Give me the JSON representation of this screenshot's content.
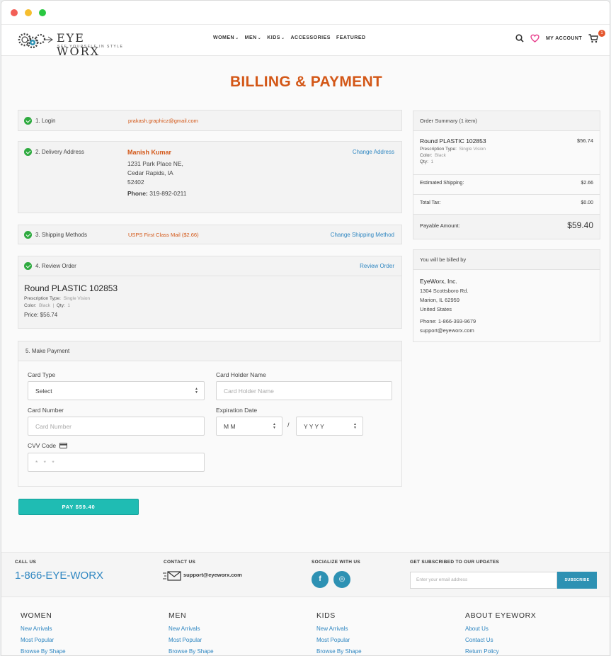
{
  "window": {
    "controls": [
      "close",
      "minimize",
      "maximize"
    ]
  },
  "header": {
    "logo_name": "EYE WORX",
    "logo_tagline": "SEE YOURSELF IN STYLE",
    "nav": [
      {
        "label": "WOMEN",
        "caret": "⌄"
      },
      {
        "label": "MEN",
        "caret": "⌄"
      },
      {
        "label": "KIDS",
        "caret": "⌄"
      },
      {
        "label": "ACCESSORIES",
        "caret": ""
      },
      {
        "label": "FEATURED",
        "caret": ""
      }
    ],
    "account": "MY ACCOUNT",
    "cart_count": "1"
  },
  "page_title": "BILLING & PAYMENT",
  "steps": {
    "login": {
      "label": "1. Login",
      "value": "prakash.graphicz@gmail.com"
    },
    "delivery": {
      "label": "2. Delivery Address",
      "name": "Manish Kumar",
      "line1": "1231 Park Place NE,",
      "line2": "Cedar Rapids, IA",
      "line3": "52402",
      "phone_label": "Phone:",
      "phone": "319-892-0211",
      "action": "Change Address"
    },
    "shipping": {
      "label": "3. Shipping Methods",
      "value": "USPS First Class Mail ($2.66)",
      "action": "Change Shipping Method"
    },
    "review": {
      "label": "4. Review Order",
      "action": "Review Order",
      "product": "Round PLASTIC 102853",
      "rx_label": "Prescription Type:",
      "rx_value": "Single Vision",
      "color_label": "Color:",
      "color_value": "Black",
      "sep": "|",
      "qty_label": "Qty:",
      "qty_value": "1",
      "price": "Price: $56.74"
    },
    "payment": {
      "label": "5. Make Payment",
      "card_type_label": "Card Type",
      "card_type_value": "Select",
      "holder_label": "Card Holder Name",
      "holder_placeholder": "Card Holder Name",
      "number_label": "Card Number",
      "number_placeholder": "Card Number",
      "exp_label": "Expiration Date",
      "exp_month": "M M",
      "exp_sep": "/",
      "exp_year": "Y Y Y Y",
      "cvv_label": "CVV Code",
      "cvv_placeholder": "* * *"
    }
  },
  "pay_button": "PAY $59.40",
  "summary": {
    "title": "Order Summary (1 item)",
    "product": "Round PLASTIC 102853",
    "product_price": "$56.74",
    "rx_label": "Prescription Type:",
    "rx_value": "Single Vision",
    "color_label": "Color:",
    "color_value": "Black",
    "qty_label": "Qty:",
    "qty_value": "1",
    "ship_label": "Estimated Shipping:",
    "ship_value": "$2.66",
    "tax_label": "Total Tax:",
    "tax_value": "$0.00",
    "payable_label": "Payable Amount:",
    "payable_value": "$59.40"
  },
  "billed_by": {
    "title": "You will be billed by",
    "company": "EyeWorx, Inc.",
    "line1": "1304 Scottsboro Rd.",
    "line2": "Marion, IL 62959",
    "line3": "United States",
    "phone": "Phone: 1-866-393-9679",
    "email": "support@eyeworx.com"
  },
  "footer": {
    "call_label": "CALL US",
    "call_value": "1-866-EYE-WORX",
    "contact_label": "CONTACT US",
    "contact_value": "support@eyeworx.com",
    "social_label": "SOCIALIZE WITH US",
    "social": [
      "f",
      "◎"
    ],
    "subscribe_label": "GET SUBSCRIBED TO OUR UPDATES",
    "subscribe_placeholder": "Enter your email address",
    "subscribe_button": "SUBSCRIBE",
    "columns": [
      {
        "title": "WOMEN",
        "links": [
          "New Arrivals",
          "Most Popular",
          "Browse By Shape"
        ]
      },
      {
        "title": "MEN",
        "links": [
          "New Arrivals",
          "Most Popular",
          "Browse By Shape"
        ]
      },
      {
        "title": "KIDS",
        "links": [
          "New Arrivals",
          "Most Popular",
          "Browse By Shape"
        ]
      },
      {
        "title": "ABOUT EYEWORX",
        "links": [
          "About Us",
          "Contact Us",
          "Return Policy"
        ]
      }
    ]
  },
  "colors": {
    "accent": "#d35717",
    "link": "#2e86c1",
    "pay": "#1fbcb3",
    "check": "#2eaa3f",
    "social": "#2d91b3"
  }
}
